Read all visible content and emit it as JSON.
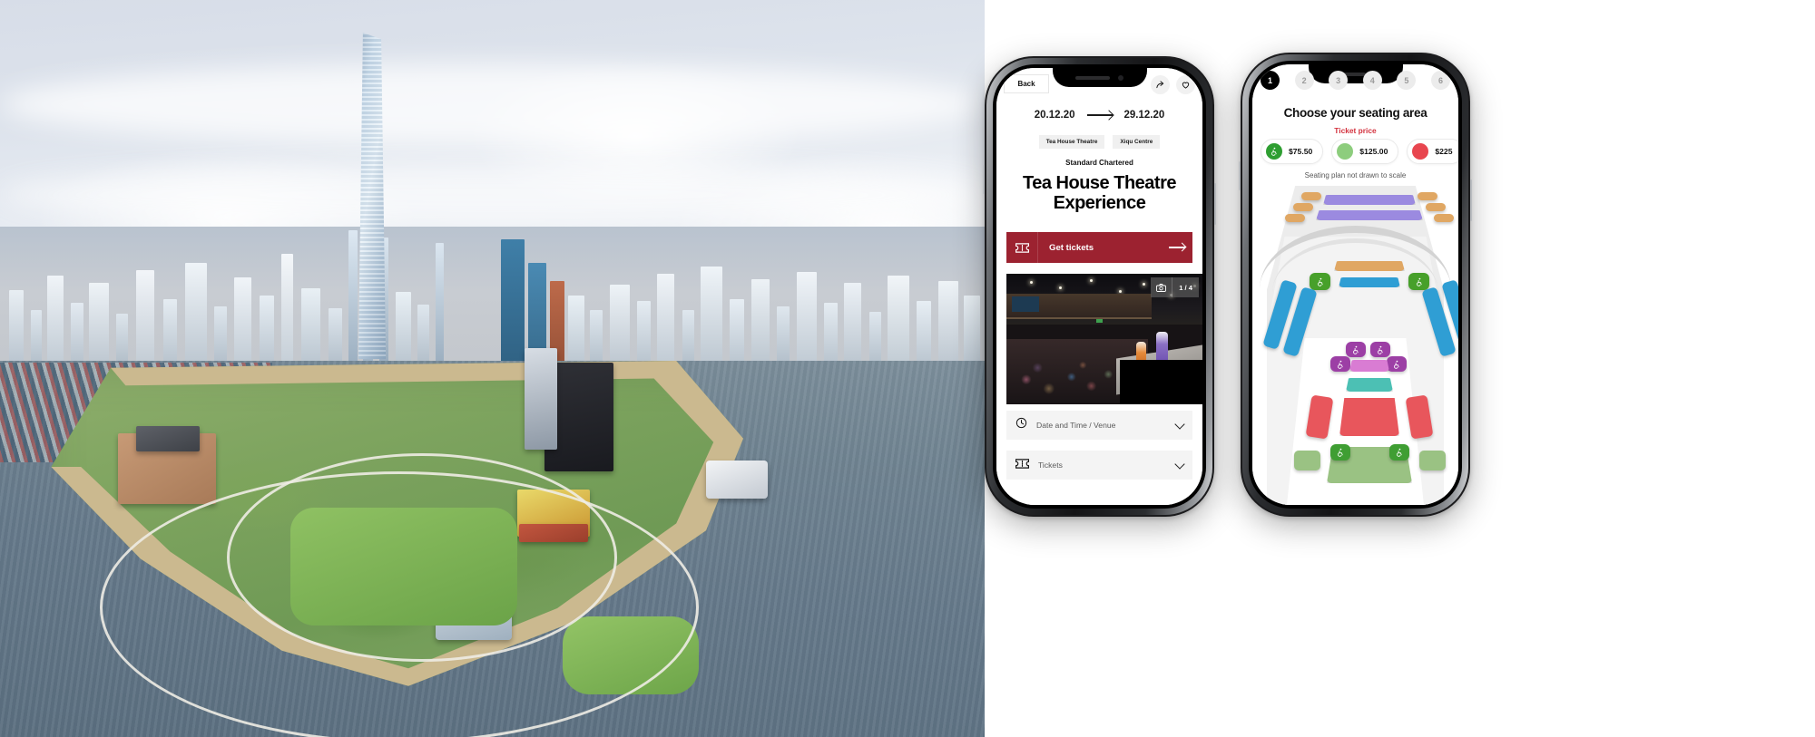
{
  "left_photo": {
    "alt": "Aerial view of West Kowloon Cultural District waterfront park, Hong Kong",
    "landmark": "ICC Tower",
    "caption": ""
  },
  "phone_detail": {
    "back_label": "Back",
    "share_icon": "share-icon",
    "favourite_icon": "heart-icon",
    "date_start": "20.12.20",
    "date_end": "29.12.20",
    "date_arrow": "arrow-right-icon",
    "tags": [
      "Tea House Theatre",
      "Xiqu Centre"
    ],
    "sponsor": "Standard Chartered",
    "title": "Tea House Theatre Experience",
    "cta": {
      "label": "Get tickets",
      "ticket_icon": "ticket-icon",
      "arrow_icon": "arrow-right-icon",
      "bg_color": "#9c2230"
    },
    "gallery": {
      "camera_icon": "camera-icon",
      "counter": "1 / 4",
      "current": 1,
      "total": 4
    },
    "accordions": [
      {
        "label": "Date and Time / Venue",
        "icon": "clock-icon",
        "chevron": "chevron-down-icon"
      },
      {
        "label": "Tickets",
        "icon": "ticket-icon",
        "chevron": "chevron-down-icon"
      }
    ]
  },
  "phone_seatmap": {
    "steps": [
      "1",
      "2",
      "3",
      "4",
      "5",
      "6"
    ],
    "active_step": 1,
    "heading": "Choose your seating area",
    "price_label": "Ticket price",
    "price_label_color": "#d3323e",
    "price_chips": [
      {
        "price": "$75.50",
        "color": "#2e9e31",
        "accessible": true,
        "icon": "wheelchair-icon"
      },
      {
        "price": "$125.00",
        "color": "#8dcd7d",
        "accessible": false,
        "icon": ""
      },
      {
        "price": "$225",
        "color": "#e8464f",
        "accessible": false,
        "icon": ""
      }
    ],
    "map_note": "Seating plan not drawn to scale",
    "legend_colors": {
      "balcony_purple": "#9b8ae0",
      "balcony_orange": "#e0a763",
      "mid_blue": "#2f9ed4",
      "accessible_green": "#47a02a",
      "accessible_purple": "#9c3fa5",
      "front_pink": "#d97cd3",
      "front_teal": "#4cc0b4",
      "premium_red": "#e8565c",
      "stalls_green": "#9ac283"
    }
  }
}
